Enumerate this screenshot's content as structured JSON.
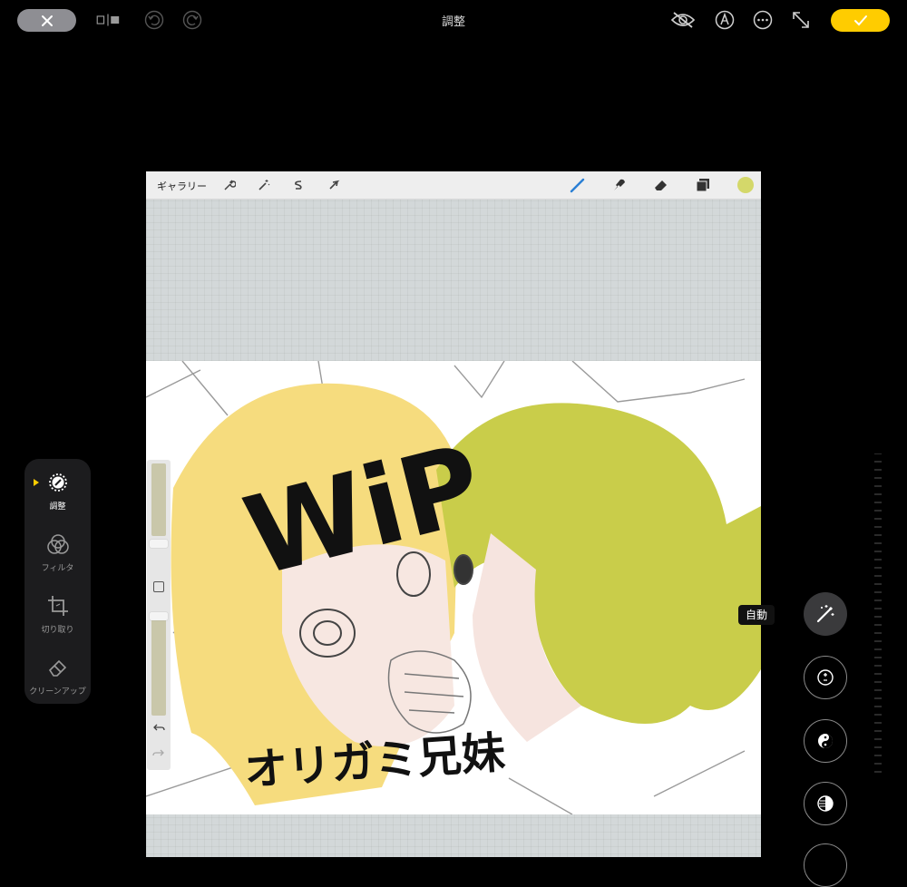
{
  "header": {
    "title": "調整",
    "cancel_icon": "close-icon",
    "done_icon": "checkmark-icon"
  },
  "canvas_app": {
    "toolbar": {
      "gallery_label": "ギャラリー",
      "color_swatch": "#d4d86a"
    },
    "artwork_text": [
      "WiP",
      "オリガミ兄妹"
    ]
  },
  "tools": [
    {
      "label": "調整",
      "icon": "adjust-icon",
      "active": true
    },
    {
      "label": "フィルタ",
      "icon": "filter-icon",
      "active": false
    },
    {
      "label": "切り取り",
      "icon": "crop-icon",
      "active": false
    },
    {
      "label": "クリーンアップ",
      "icon": "eraser-icon",
      "active": false
    }
  ],
  "adjust": {
    "auto_label": "自動"
  },
  "colors": {
    "accent": "#ffcc00",
    "background": "#000000",
    "panel": "#1c1c1e"
  }
}
